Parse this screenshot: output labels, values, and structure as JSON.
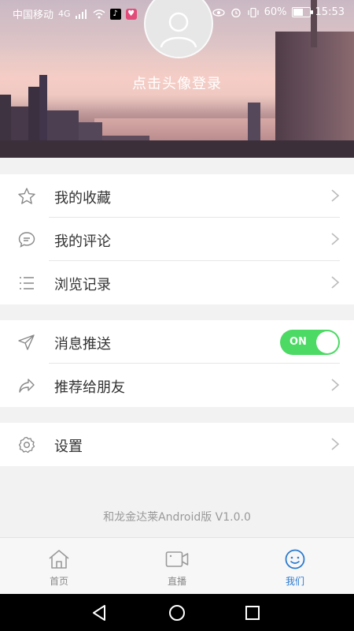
{
  "status_bar": {
    "carrier": "中国移动",
    "signal_tag": "4G",
    "battery_percent": "60%",
    "time": "15:53"
  },
  "profile": {
    "login_prompt": "点击头像登录"
  },
  "menu_group_1": [
    {
      "label": "我的收藏",
      "icon": "star-icon"
    },
    {
      "label": "我的评论",
      "icon": "comment-icon"
    },
    {
      "label": "浏览记录",
      "icon": "list-icon"
    }
  ],
  "menu_group_2": [
    {
      "label": "消息推送",
      "icon": "send-icon",
      "toggle": "ON"
    },
    {
      "label": "推荐给朋友",
      "icon": "share-icon"
    }
  ],
  "menu_group_3": [
    {
      "label": "设置",
      "icon": "gear-icon"
    }
  ],
  "version_text": "和龙金达莱Android版 V1.0.0",
  "tabs": [
    {
      "label": "首页",
      "icon": "home-icon",
      "active": false
    },
    {
      "label": "直播",
      "icon": "video-camera-icon",
      "active": false
    },
    {
      "label": "我们",
      "icon": "smiley-icon",
      "active": true
    }
  ],
  "colors": {
    "accent": "#2b7bd1",
    "toggle_on": "#4cd964"
  }
}
